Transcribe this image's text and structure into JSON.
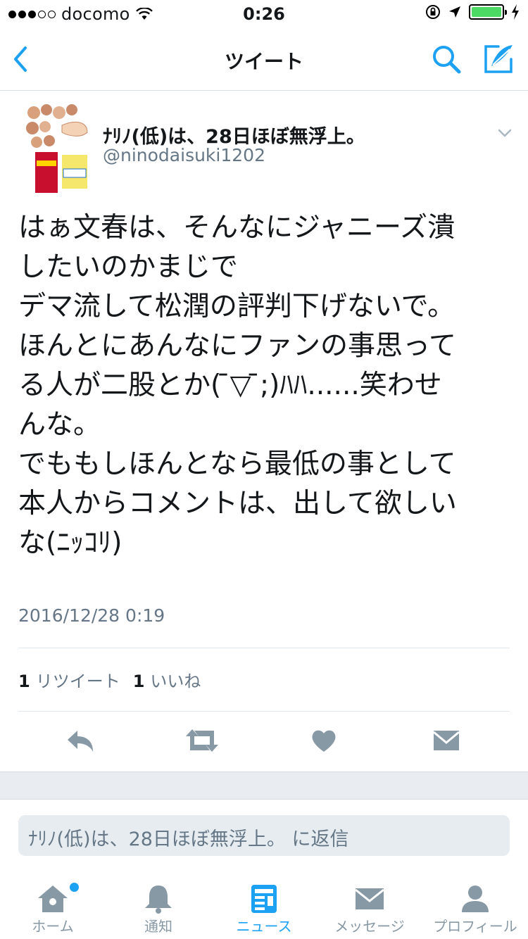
{
  "status_bar": {
    "carrier": "docomo",
    "time": "0:26"
  },
  "nav": {
    "title": "ツイート"
  },
  "tweet": {
    "author_name": "ﾅﾘﾉ(低)は、28日ほぼ無浮上。",
    "handle": "@ninodaisuki1202",
    "text": "はぁ文春は、そんなにジャニーズ潰\nしたいのかまじで\nデマ流して松潤の評判下げないで。\nほんとにあんなにファンの事思って\nる人が二股とか( ̄▽ ̄;)ﾊﾊ......笑わせ\nんな。\nでももしほんとなら最低の事として\n本人からコメントは、出して欲しい\nな(ﾆｯｺﾘ)",
    "timestamp": "2016/12/28 0:19",
    "retweets_count": "1",
    "retweets_label": "リツイート",
    "likes_count": "1",
    "likes_label": "いいね"
  },
  "reply": {
    "placeholder": "ﾅﾘﾉ(低)は、28日ほぼ無浮上。 に返信"
  },
  "tabbar": {
    "items": [
      {
        "label": "ホーム",
        "icon": "home-icon"
      },
      {
        "label": "通知",
        "icon": "bell-icon"
      },
      {
        "label": "ニュース",
        "icon": "news-icon"
      },
      {
        "label": "メッセージ",
        "icon": "mail-icon"
      },
      {
        "label": "プロフィール",
        "icon": "person-icon"
      }
    ]
  },
  "colors": {
    "accent": "#1da1f2",
    "muted": "#657786",
    "icon_gray": "#8899a6",
    "battery": "#4cd964"
  }
}
